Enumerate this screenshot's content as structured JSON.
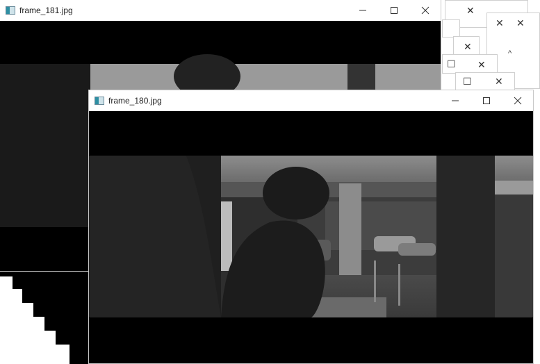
{
  "windows": {
    "back": {
      "title": "frame_181.jpg"
    },
    "front": {
      "title": "frame_180.jpg"
    }
  },
  "controls": {
    "minimize": "—",
    "maximize": "☐",
    "close": "✕"
  }
}
